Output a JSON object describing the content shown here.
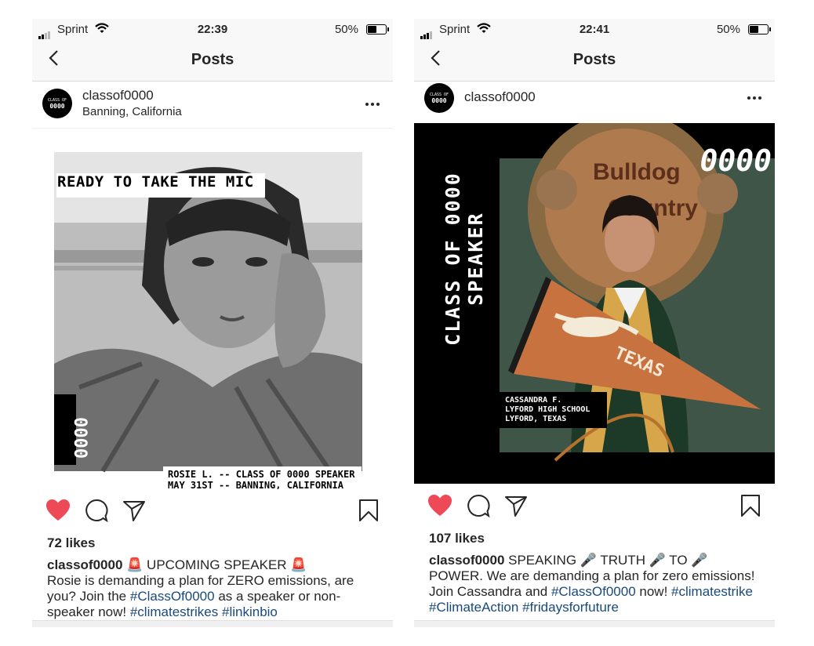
{
  "left": {
    "status": {
      "carrier": "Sprint",
      "time": "22:39",
      "battery": "50%",
      "battery_level": 0.5
    },
    "nav": {
      "title": "Posts"
    },
    "post": {
      "avatar_line1": "CLASS OF",
      "avatar_line2": "0000",
      "username": "classof0000",
      "location": "Banning, California",
      "image": {
        "headline": "READY TO TAKE THE MIC",
        "side_text": "0000",
        "caption_line1": "ROSIE L. -- CLASS OF 0000 SPEAKER",
        "caption_line2": "MAY 31ST -- BANNING, CALIFORNIA"
      },
      "likes": "72 likes",
      "caption_user": "classof0000",
      "caption_siren1": "🚨",
      "caption_headline": " UPCOMING SPEAKER ",
      "caption_siren2": "🚨",
      "caption_text1": "Rosie is demanding a plan for ZERO emissions, are you? Join the ",
      "tag1": "#ClassOf0000",
      "caption_text2": " as a speaker or non-speaker now! ",
      "tag2": "#climatestrikes",
      "tag3": "#linkinbio"
    }
  },
  "right": {
    "status": {
      "carrier": "Sprint",
      "time": "22:41",
      "battery": "50%",
      "battery_level": 0.5
    },
    "nav": {
      "title": "Posts"
    },
    "post": {
      "avatar_line1": "CLASS OF",
      "avatar_line2": "0000",
      "username": "classof0000",
      "image": {
        "vertical_title": "CLASS OF 0000 SPEAKER",
        "corner_number": "0000",
        "name_line1": "CASSANDRA F.",
        "name_line2": "LYFORD HIGH SCHOOL",
        "name_line3": "LYFORD, TEXAS",
        "sign_text1": "Bulldog",
        "sign_text2": "Country",
        "pennant_text": "TEXAS"
      },
      "likes": "107 likes",
      "caption_user": "classof0000",
      "caption_text1": " SPEAKING ",
      "mic1": "🎤",
      "caption_text2": " TRUTH ",
      "mic2": "🎤",
      "caption_text3": " TO ",
      "mic3": "🎤",
      "caption_text4": " POWER. We are demanding a plan for zero emissions! Join Cassandra and ",
      "tag1": "#ClassOf0000",
      "caption_text5": " now! ",
      "tag2": "#climatestrike",
      "tag3": "#ClimateAction",
      "tag4": "#fridaysforfuture"
    }
  },
  "colors": {
    "heart": "#ed4956",
    "link": "#1a4a7a",
    "text": "#262626",
    "texas_orange": "#c8723f"
  }
}
